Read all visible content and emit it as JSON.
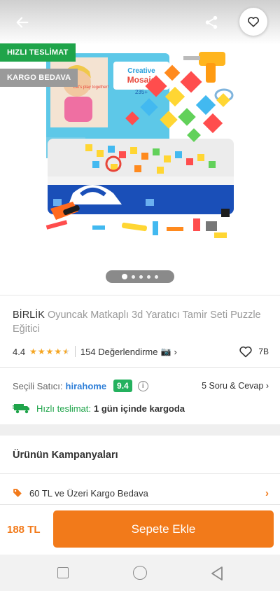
{
  "badges": {
    "fast_delivery": "HIZLI TESLİMAT",
    "free_cargo": "KARGO BEDAVA"
  },
  "product": {
    "brand": "BİRLİK",
    "name": "Oyuncak Matkaplı 3d Yaratıcı Tamir Seti Puzzle Eğitici",
    "image_count": 5,
    "active_image": 1,
    "box_text": {
      "line1": "Creative",
      "line2": "Mosaic",
      "pieces": "235+",
      "tagline": "Let's play together!"
    }
  },
  "rating": {
    "value": "4.4",
    "stars": 4.4,
    "reviews": "154 Değerlendirme",
    "likes": "7B"
  },
  "seller": {
    "label": "Seçili Satıcı:",
    "name": "hirahome",
    "score": "9.4",
    "qa": "5 Soru & Cevap"
  },
  "delivery": {
    "label": "Hızlı teslimat:",
    "value": "1 gün içinde kargoda"
  },
  "campaigns": {
    "title": "Ürünün Kampanyaları",
    "items": [
      {
        "text": "60 TL ve Üzeri Kargo Bedava"
      }
    ]
  },
  "purchase": {
    "price": "188 TL",
    "button": "Sepete Ekle"
  },
  "colors": {
    "accent": "#f27a1a",
    "fast_green": "#1fa44a",
    "seller_blue": "#2f7fd8",
    "score_green": "#24b15e",
    "star": "#f5a623"
  },
  "icons": {
    "back": "arrow-left-icon",
    "share": "share-icon",
    "favorite": "heart-icon",
    "camera": "camera-icon",
    "info": "info-icon",
    "truck": "truck-icon",
    "tag": "tag-icon"
  }
}
